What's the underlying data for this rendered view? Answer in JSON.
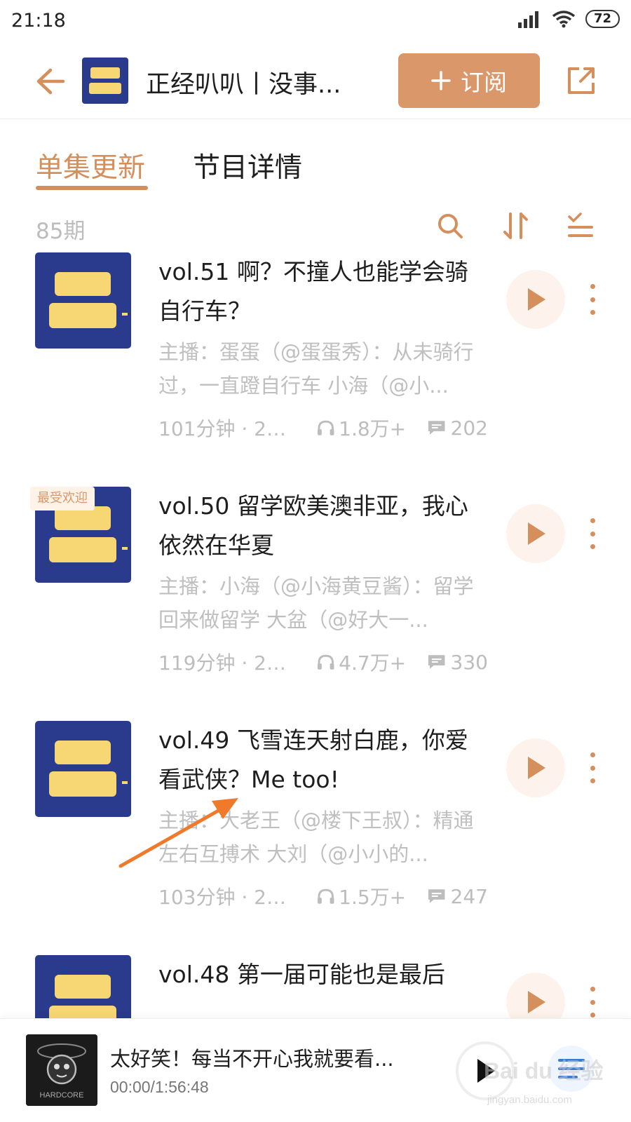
{
  "status_bar": {
    "time": "21:18",
    "battery": "72"
  },
  "header": {
    "title": "正经叭叭丨没事...",
    "subscribe_label": "订阅"
  },
  "tabs": [
    {
      "label": "单集更新",
      "active": true
    },
    {
      "label": "节目详情",
      "active": false
    }
  ],
  "toolbar": {
    "count": "85期"
  },
  "episodes": [
    {
      "title": "vol.51 啊？不撞人也能学会骑自行车？",
      "desc": "主播：蛋蛋（@蛋蛋秀）：从未骑行过，一直蹬自行车 小海（@小...",
      "duration": "101分钟 · 202...",
      "plays": "1.8万+",
      "comments": "202",
      "badge": ""
    },
    {
      "title": "vol.50 留学欧美澳非亚，我心依然在华夏",
      "desc": "主播：小海（@小海黄豆酱）：留学回来做留学 大盆（@好大一...",
      "duration": "119分钟 · 202...",
      "plays": "4.7万+",
      "comments": "330",
      "badge": "最受欢迎"
    },
    {
      "title": "vol.49 飞雪连天射白鹿，你爱看武侠？Me too!",
      "desc": "主播：大老王（@楼下王叔）：精通左右互搏术 大刘（@小小的...",
      "duration": "103分钟 · 202...",
      "plays": "1.5万+",
      "comments": "247",
      "badge": ""
    },
    {
      "title": "vol.48 第一届可能也是最后",
      "desc": "",
      "duration": "",
      "plays": "",
      "comments": "",
      "badge": ""
    }
  ],
  "player": {
    "title": "太好笑！每当不开心我就要看...",
    "time": "00:00/1:56:48",
    "cover_text": "HARDCORE"
  },
  "watermark": {
    "text": "Bai du 经验",
    "sub": "jingyan.baidu.com"
  },
  "colors": {
    "accent": "#d58f5c",
    "subscribe_bg": "#d9976a",
    "cover_bg": "#2a3a8c",
    "cover_text": "#f7d774"
  }
}
